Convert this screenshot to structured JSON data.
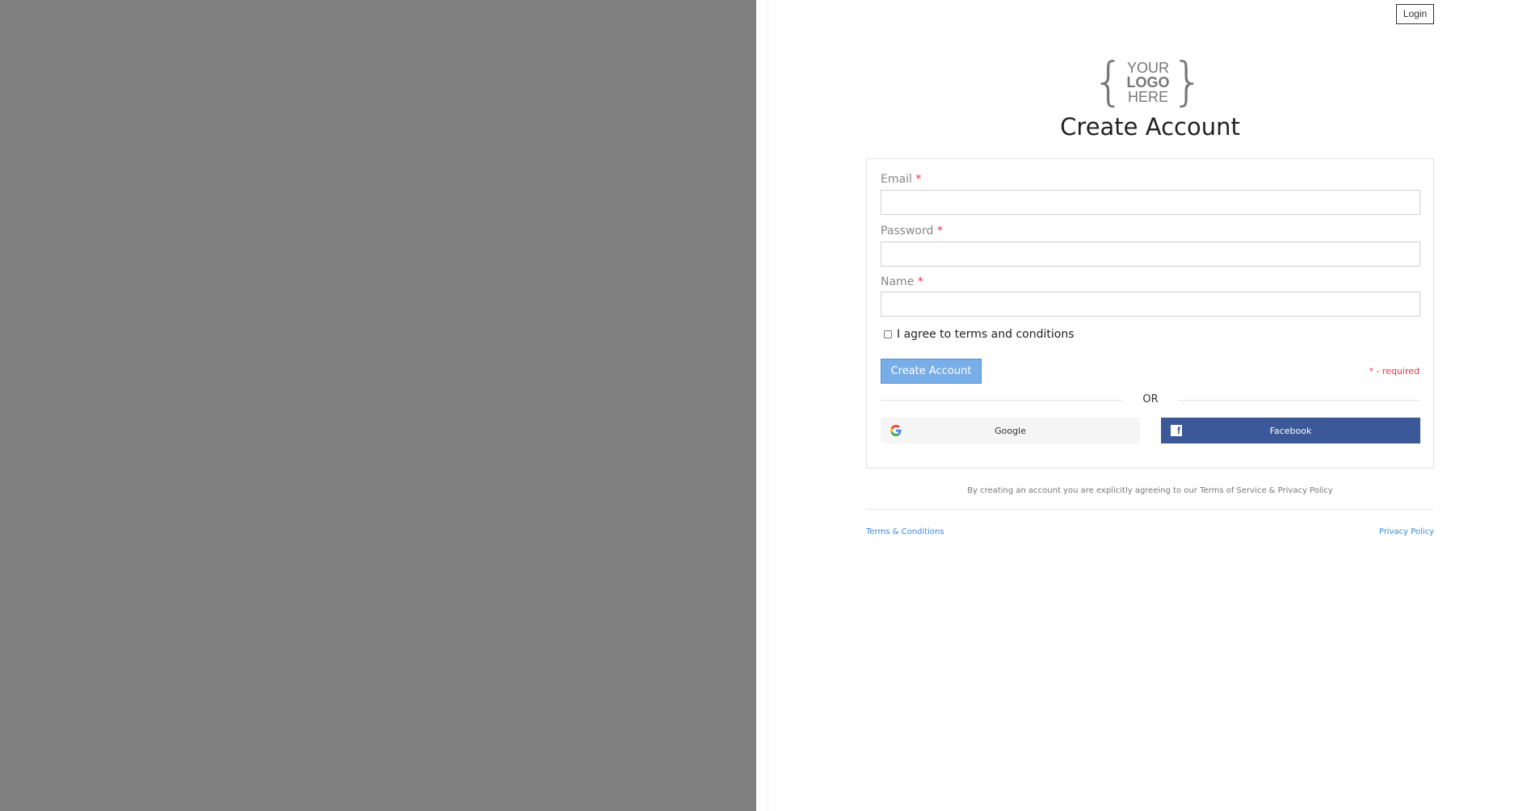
{
  "header": {
    "login_label": "Login"
  },
  "logo": {
    "line1": "YOUR",
    "line2": "LOGO",
    "line3": "HERE"
  },
  "page": {
    "title": "Create Account"
  },
  "form": {
    "email_label": "Email",
    "email_value": "",
    "password_label": "Password",
    "password_value": "",
    "name_label": "Name",
    "name_value": "",
    "required_marker": "*",
    "agree_label": "I agree to terms and conditions",
    "agree_checked": false,
    "submit_label": "Create Account",
    "required_note": "* - required",
    "or_label": "OR"
  },
  "social": {
    "google_label": "Google",
    "facebook_label": "Facebook",
    "google_icon": "google-icon",
    "facebook_icon": "facebook-icon"
  },
  "footer": {
    "agreement_text": "By creating an account you are explicitly agreeing to our Terms of Service & Privacy Policy",
    "terms_label": "Terms & Conditions",
    "privacy_label": "Privacy Policy"
  },
  "colors": {
    "left_panel": "#808080",
    "primary_button": "#78aee8",
    "facebook": "#3b5998",
    "required": "#e8334a",
    "link": "#3a8ad6"
  }
}
